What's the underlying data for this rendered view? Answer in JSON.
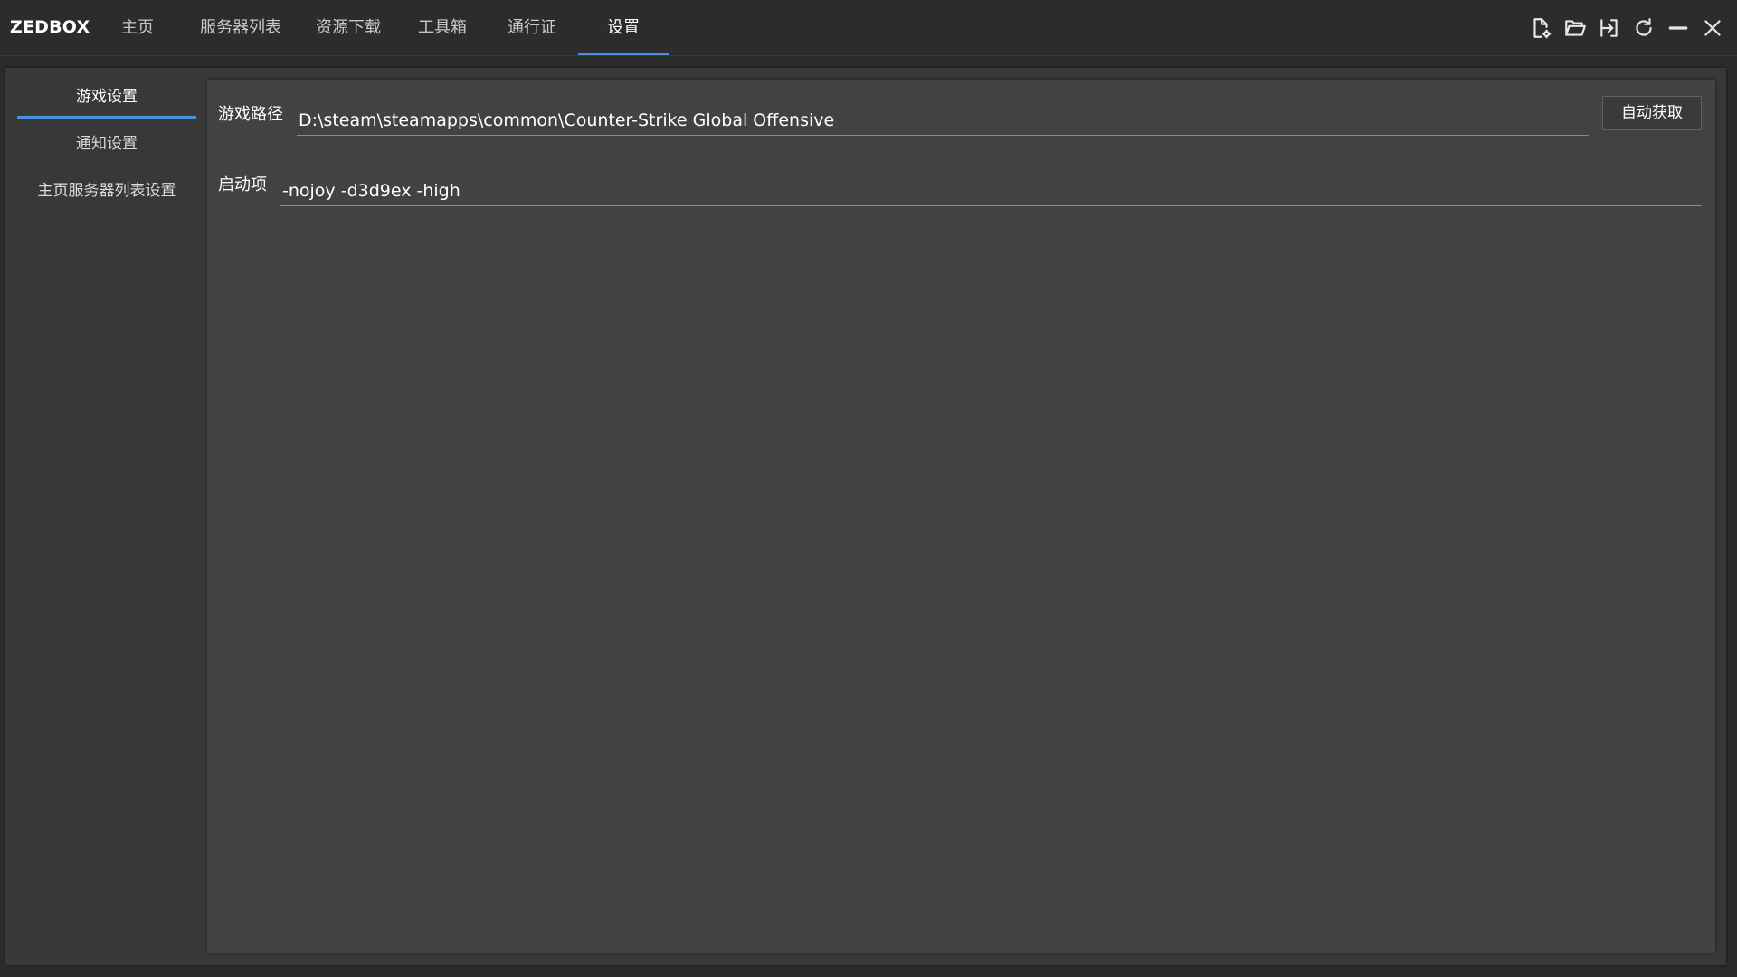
{
  "app": {
    "title": "ZEDBOX"
  },
  "nav": {
    "tabs": [
      {
        "label": "主页"
      },
      {
        "label": "服务器列表"
      },
      {
        "label": "资源下载"
      },
      {
        "label": "工具箱"
      },
      {
        "label": "通行证"
      },
      {
        "label": "设置"
      }
    ],
    "active": "设置"
  },
  "window_icons": [
    "file-settings-icon",
    "folder-open-icon",
    "login-icon",
    "refresh-icon",
    "minimize-icon",
    "close-icon"
  ],
  "sidebar": {
    "items": [
      {
        "label": "游戏设置"
      },
      {
        "label": "通知设置"
      },
      {
        "label": "主页服务器列表设置"
      }
    ],
    "active": "游戏设置"
  },
  "settings": {
    "game_path": {
      "label": "游戏路径",
      "value": "D:\\steam\\steamapps\\common\\Counter-Strike Global Offensive",
      "button_label": "自动获取"
    },
    "launch_options": {
      "label": "启动项",
      "value": "-nojoy -d3d9ex -high"
    }
  },
  "colors": {
    "accent": "#4a90e2",
    "background": "#2b2b2b",
    "panel": "#424242"
  }
}
